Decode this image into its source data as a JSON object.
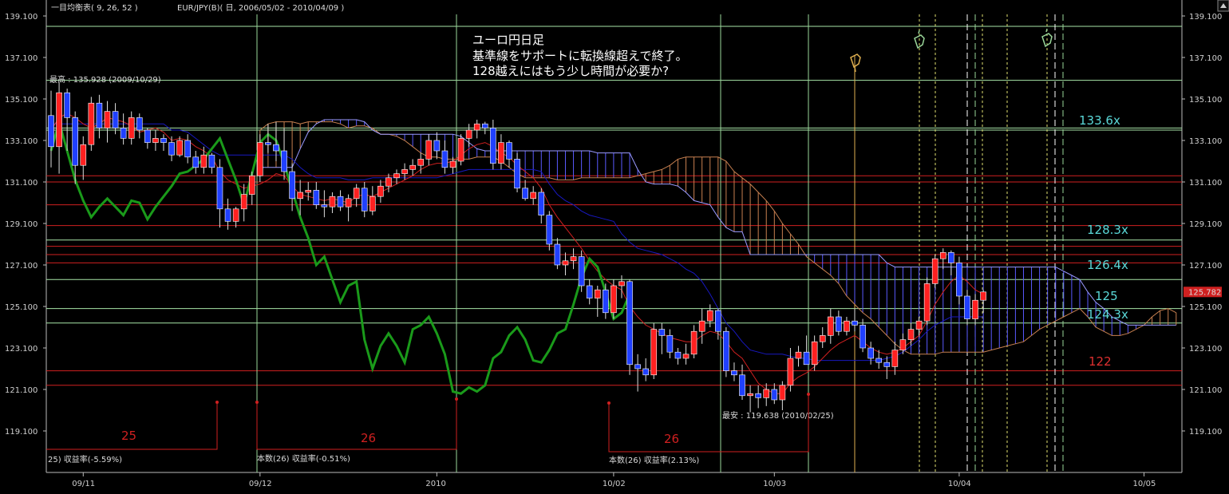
{
  "header": {
    "indicator": "一目均衡表( 9, 26, 52 )",
    "symbol_info": "EUR/JPY(B)( 日, 2006/05/02 - 2010/04/09 )"
  },
  "annotation": [
    "ユーロ円日足",
    "基準線をサポートに転換線超えで終了。",
    "128越えにはもう少し時間が必要か?"
  ],
  "max_label": "最高 : 135.928 (2009/10/29)",
  "min_label": "最安 : 119.638 (2010/02/25)",
  "count_labels": [
    {
      "num": "25",
      "text": "25) 収益率(-5.59%)"
    },
    {
      "num": "26",
      "text": "本数(26) 収益率(-0.51%)"
    },
    {
      "num": "26",
      "text": "本数(26) 収益率(2.13%)"
    }
  ],
  "level_labels": [
    {
      "text": "133.6x",
      "color": "#5ad8d8"
    },
    {
      "text": "128.3x",
      "color": "#5ad8d8"
    },
    {
      "text": "126.4x",
      "color": "#5ad8d8"
    },
    {
      "text": "125",
      "color": "#5ad8d8"
    },
    {
      "text": "124.3x",
      "color": "#5ad8d8"
    },
    {
      "text": "122",
      "color": "#e03030"
    }
  ],
  "current_price": "125.782",
  "colors": {
    "up": "#ff2020",
    "down": "#2040ff",
    "chikou": "#1a9a1a",
    "tenkan": "#d02020",
    "kijun": "#1818c0",
    "cloud_bear": "#5a5aff",
    "cloud_bull": "#c88050",
    "hline_green": "#a8e6a8",
    "hline_red": "#d02020",
    "vline": "#9ad79a",
    "vline_yellow": "#e0e070"
  },
  "chart_data": {
    "type": "candlestick",
    "title": "ユーロ円日足",
    "ylim": [
      117.7,
      139.6
    ],
    "y_ticks": [
      "139.100",
      "137.100",
      "135.100",
      "133.100",
      "131.100",
      "129.100",
      "127.100",
      "125.100",
      "123.100",
      "121.100",
      "119.100"
    ],
    "x_ticks": [
      {
        "label": "09/11",
        "index": 4
      },
      {
        "label": "09/12",
        "index": 26
      },
      {
        "label": "2010",
        "index": 48
      },
      {
        "label": "10/02",
        "index": 70
      },
      {
        "label": "10/03",
        "index": 90
      },
      {
        "label": "10/04",
        "index": 113
      },
      {
        "label": "10/05",
        "index": 136
      }
    ],
    "candles": [
      [
        134.3,
        135.5,
        131.8,
        132.8
      ],
      [
        132.8,
        135.9,
        131.5,
        135.4
      ],
      [
        135.4,
        135.6,
        132.6,
        134.2
      ],
      [
        134.2,
        134.5,
        131.0,
        131.9
      ],
      [
        131.9,
        133.3,
        131.2,
        132.9
      ],
      [
        132.9,
        135.2,
        132.6,
        134.9
      ],
      [
        134.9,
        135.3,
        133.2,
        133.7
      ],
      [
        133.7,
        135.0,
        133.0,
        134.5
      ],
      [
        134.5,
        134.9,
        133.4,
        133.7
      ],
      [
        133.7,
        134.4,
        132.9,
        133.2
      ],
      [
        133.2,
        134.5,
        132.9,
        134.2
      ],
      [
        134.2,
        134.4,
        133.2,
        133.6
      ],
      [
        133.6,
        133.7,
        132.7,
        133.0
      ],
      [
        133.0,
        133.6,
        132.6,
        133.2
      ],
      [
        133.2,
        133.4,
        132.6,
        133.0
      ],
      [
        133.0,
        133.3,
        132.1,
        132.4
      ],
      [
        132.4,
        133.3,
        132.3,
        133.1
      ],
      [
        133.1,
        133.4,
        132.0,
        132.3
      ],
      [
        132.3,
        132.6,
        131.5,
        131.8
      ],
      [
        131.8,
        132.8,
        131.5,
        132.4
      ],
      [
        132.4,
        132.5,
        131.5,
        131.8
      ],
      [
        131.8,
        132.2,
        128.9,
        129.8
      ],
      [
        129.8,
        130.3,
        128.8,
        129.2
      ],
      [
        129.2,
        129.9,
        128.9,
        129.8
      ],
      [
        129.8,
        131.0,
        129.2,
        130.5
      ],
      [
        130.5,
        131.6,
        130.0,
        131.4
      ],
      [
        131.4,
        133.4,
        131.1,
        133.0
      ],
      [
        133.0,
        133.9,
        132.5,
        132.9
      ],
      [
        132.9,
        134.0,
        132.1,
        132.6
      ],
      [
        132.6,
        133.7,
        131.2,
        131.6
      ],
      [
        131.6,
        132.0,
        129.7,
        130.3
      ],
      [
        130.3,
        131.2,
        129.5,
        130.6
      ],
      [
        130.6,
        131.1,
        130.2,
        130.7
      ],
      [
        130.7,
        131.1,
        129.8,
        130.0
      ],
      [
        130.0,
        130.7,
        129.4,
        129.9
      ],
      [
        129.9,
        130.6,
        129.6,
        130.4
      ],
      [
        130.4,
        130.7,
        129.7,
        129.9
      ],
      [
        129.9,
        130.5,
        129.2,
        130.3
      ],
      [
        130.3,
        131.0,
        129.9,
        130.8
      ],
      [
        130.8,
        131.1,
        129.4,
        129.7
      ],
      [
        129.7,
        130.9,
        129.5,
        130.4
      ],
      [
        130.4,
        131.2,
        130.1,
        130.9
      ],
      [
        130.9,
        131.5,
        130.6,
        131.3
      ],
      [
        131.3,
        131.7,
        131.0,
        131.5
      ],
      [
        131.5,
        132.0,
        131.2,
        131.7
      ],
      [
        131.7,
        132.2,
        131.4,
        131.9
      ],
      [
        131.9,
        132.5,
        131.5,
        132.2
      ],
      [
        132.2,
        133.4,
        131.9,
        133.1
      ],
      [
        133.1,
        133.5,
        132.2,
        132.6
      ],
      [
        132.6,
        133.1,
        131.5,
        131.8
      ],
      [
        131.8,
        132.3,
        131.5,
        132.1
      ],
      [
        132.1,
        133.4,
        131.9,
        133.2
      ],
      [
        133.2,
        133.9,
        132.8,
        133.6
      ],
      [
        133.6,
        134.1,
        133.2,
        133.9
      ],
      [
        133.9,
        134.0,
        133.4,
        133.7
      ],
      [
        133.7,
        134.1,
        131.7,
        132.0
      ],
      [
        132.0,
        133.4,
        131.7,
        133.0
      ],
      [
        133.0,
        133.1,
        131.8,
        132.2
      ],
      [
        132.2,
        132.5,
        130.6,
        130.8
      ],
      [
        130.8,
        131.2,
        130.2,
        130.3
      ],
      [
        130.3,
        130.9,
        130.0,
        130.6
      ],
      [
        130.6,
        130.8,
        129.1,
        129.5
      ],
      [
        129.5,
        129.7,
        127.8,
        128.1
      ],
      [
        128.1,
        128.4,
        126.9,
        127.1
      ],
      [
        127.1,
        127.7,
        126.6,
        127.3
      ],
      [
        127.3,
        127.9,
        126.9,
        127.5
      ],
      [
        127.5,
        127.8,
        125.8,
        126.1
      ],
      [
        126.1,
        126.4,
        125.2,
        125.5
      ],
      [
        125.5,
        126.1,
        124.6,
        125.9
      ],
      [
        125.9,
        126.2,
        124.5,
        124.8
      ],
      [
        124.8,
        126.4,
        124.5,
        126.1
      ],
      [
        126.1,
        126.6,
        125.5,
        126.3
      ],
      [
        126.3,
        126.4,
        121.8,
        122.3
      ],
      [
        122.3,
        122.8,
        121.0,
        122.1
      ],
      [
        122.1,
        122.6,
        121.5,
        121.8
      ],
      [
        121.8,
        124.3,
        121.6,
        124.0
      ],
      [
        124.0,
        124.3,
        122.8,
        123.7
      ],
      [
        123.7,
        124.0,
        122.6,
        122.9
      ],
      [
        122.9,
        123.1,
        122.3,
        122.6
      ],
      [
        122.6,
        123.3,
        122.3,
        122.8
      ],
      [
        122.8,
        124.2,
        122.6,
        123.9
      ],
      [
        123.9,
        125.0,
        123.3,
        124.4
      ],
      [
        124.4,
        125.2,
        124.1,
        124.9
      ],
      [
        124.9,
        125.0,
        123.5,
        123.9
      ],
      [
        123.9,
        124.1,
        121.7,
        122.0
      ],
      [
        122.0,
        122.4,
        121.5,
        121.8
      ],
      [
        121.8,
        122.3,
        120.6,
        120.8
      ],
      [
        120.8,
        121.3,
        120.0,
        120.9
      ],
      [
        120.9,
        121.3,
        120.2,
        120.7
      ],
      [
        120.7,
        121.4,
        120.3,
        121.1
      ],
      [
        121.1,
        121.4,
        120.4,
        120.6
      ],
      [
        120.6,
        121.5,
        120.1,
        121.3
      ],
      [
        121.3,
        123.1,
        121.0,
        122.6
      ],
      [
        122.6,
        123.2,
        122.2,
        122.9
      ],
      [
        122.9,
        123.7,
        122.5,
        122.3
      ],
      [
        122.3,
        123.7,
        122.0,
        123.4
      ],
      [
        123.4,
        124.1,
        123.1,
        123.7
      ],
      [
        123.7,
        125.0,
        123.3,
        124.6
      ],
      [
        124.6,
        124.9,
        123.7,
        123.9
      ],
      [
        123.9,
        124.6,
        123.7,
        124.4
      ],
      [
        124.4,
        125.0,
        123.9,
        124.2
      ],
      [
        124.2,
        124.5,
        122.9,
        123.1
      ],
      [
        123.1,
        123.4,
        122.3,
        122.6
      ],
      [
        122.6,
        123.0,
        122.1,
        122.4
      ],
      [
        122.4,
        122.7,
        121.6,
        122.2
      ],
      [
        122.2,
        123.4,
        121.8,
        123.0
      ],
      [
        123.0,
        123.8,
        122.8,
        123.5
      ],
      [
        123.5,
        124.3,
        123.2,
        124.0
      ],
      [
        124.0,
        124.6,
        123.7,
        124.4
      ],
      [
        124.4,
        126.5,
        124.2,
        126.2
      ],
      [
        126.2,
        127.6,
        126.0,
        127.4
      ],
      [
        127.4,
        127.9,
        126.9,
        127.7
      ],
      [
        127.7,
        127.8,
        126.6,
        127.2
      ],
      [
        127.2,
        127.5,
        125.2,
        125.6
      ],
      [
        125.6,
        125.9,
        124.2,
        124.5
      ],
      [
        124.5,
        125.7,
        124.2,
        125.4
      ],
      [
        125.4,
        125.9,
        124.8,
        125.8
      ]
    ],
    "tenkan": [
      133.6,
      134.2,
      134.4,
      134.2,
      133.9,
      133.7,
      133.9,
      134.2,
      134.1,
      134.0,
      133.8,
      133.5,
      133.6,
      133.7,
      133.5,
      133.1,
      133.2,
      133.1,
      132.8,
      132.6,
      132.3,
      131.6,
      131.2,
      131.0,
      130.8,
      130.9,
      131.0,
      131.2,
      131.5,
      131.4,
      130.9,
      130.5,
      130.4,
      130.3,
      130.2,
      130.3,
      130.2,
      130.1,
      130.4,
      130.5,
      130.4,
      130.6,
      130.8,
      131.0,
      131.2,
      131.4,
      131.7,
      131.9,
      132.0,
      132.0,
      132.1,
      132.4,
      132.7,
      132.9,
      133.0,
      132.8,
      132.5,
      132.3,
      131.9,
      131.6,
      131.3,
      130.8,
      130.0,
      129.4,
      128.9,
      128.4,
      127.9,
      127.3,
      126.8,
      126.4,
      126.1,
      125.9,
      125.1,
      124.6,
      124.2,
      124.0,
      123.8,
      123.6,
      123.5,
      123.4,
      123.4,
      123.7,
      123.9,
      123.8,
      123.4,
      122.9,
      122.6,
      122.0,
      121.4,
      121.1,
      120.9,
      120.9,
      121.4,
      121.7,
      121.9,
      122.2,
      122.6,
      123.0,
      123.3,
      123.5,
      123.7,
      123.4,
      123.1,
      122.9,
      122.8,
      122.9,
      123.1,
      123.4,
      123.7,
      124.4,
      125.2,
      125.8,
      126.3,
      126.6,
      126.3,
      125.9,
      125.7
    ],
    "kijun": [
      133.9,
      133.9,
      133.9,
      133.9,
      133.9,
      133.9,
      133.9,
      133.9,
      133.9,
      133.9,
      133.9,
      133.9,
      133.9,
      133.9,
      133.9,
      133.6,
      133.6,
      133.5,
      133.2,
      132.9,
      132.6,
      132.4,
      132.4,
      132.4,
      132.4,
      132.4,
      132.4,
      132.4,
      132.4,
      132.4,
      132.2,
      131.8,
      131.5,
      131.3,
      131.3,
      131.3,
      131.3,
      131.2,
      131.2,
      131.2,
      131.3,
      131.3,
      131.3,
      131.3,
      131.3,
      131.3,
      131.3,
      131.3,
      131.3,
      131.4,
      131.5,
      131.6,
      131.7,
      131.7,
      131.7,
      131.7,
      131.7,
      131.7,
      131.7,
      131.7,
      131.7,
      131.6,
      131.0,
      130.5,
      130.2,
      130.0,
      129.7,
      129.5,
      129.4,
      129.3,
      129.2,
      128.6,
      128.2,
      127.9,
      127.8,
      127.7,
      127.6,
      127.4,
      127.2,
      126.9,
      126.7,
      126.3,
      125.7,
      125.0,
      124.3,
      123.9,
      123.4,
      123.0,
      122.9,
      122.8,
      122.8,
      122.8,
      122.7,
      122.6,
      122.6,
      122.5,
      122.5,
      122.5,
      122.5,
      122.5,
      122.5,
      122.5,
      122.5,
      122.5,
      122.6,
      122.7,
      122.9,
      123.2,
      123.5,
      123.9,
      124.2,
      124.4,
      124.6,
      124.6,
      124.6,
      124.6,
      124.6
    ],
    "chikou": [
      132.6,
      134.0,
      132.6,
      131.2,
      130.2,
      129.4,
      129.9,
      130.3,
      129.9,
      129.5,
      130.2,
      130.1,
      129.3,
      129.9,
      130.4,
      130.9,
      131.5,
      131.6,
      131.9,
      132.2,
      132.7,
      133.2,
      132.2,
      131.2,
      130.0,
      131.5,
      133.0,
      133.4,
      133.1,
      132.0,
      130.7,
      129.4,
      128.4,
      127.1,
      127.5,
      126.4,
      125.3,
      126.1,
      126.3,
      123.5,
      122.1,
      123.2,
      123.8,
      123.2,
      122.4,
      124.0,
      124.2,
      124.6,
      123.8,
      122.8,
      121.0,
      120.9,
      121.2,
      121.0,
      121.3,
      122.6,
      122.9,
      123.7,
      124.1,
      123.5,
      122.5,
      122.4,
      123.0,
      123.8,
      124.0,
      125.2,
      126.5,
      127.4,
      127.0,
      125.8,
      124.5,
      124.8,
      125.7
    ],
    "senkou_a": [
      133.6,
      133.9,
      134.0,
      134.0,
      134.0,
      133.9,
      134.0,
      134.0,
      134.0,
      134.0,
      133.9,
      133.7,
      133.8,
      133.8,
      133.7,
      133.4,
      133.4,
      133.3,
      133.1,
      132.8,
      132.5,
      132.3,
      132.3,
      132.2,
      132.2,
      132.2,
      132.2,
      132.3,
      132.3,
      132.3,
      132.1,
      131.8,
      131.5,
      131.3,
      131.3,
      131.3,
      131.3,
      131.2,
      131.2,
      131.2,
      131.3,
      131.3,
      131.3,
      131.3,
      131.3,
      131.3,
      131.3,
      131.4,
      131.5,
      131.6,
      131.7,
      131.9,
      132.2,
      132.3,
      132.3,
      132.3,
      132.3,
      132.3,
      132.1,
      131.6,
      131.3,
      131.0,
      130.6,
      130.2,
      129.7,
      129.1,
      128.6,
      128.1,
      127.5,
      127.2,
      126.9,
      126.6,
      126.2,
      125.6,
      125.2,
      124.8,
      124.5,
      124.1,
      123.7,
      123.3,
      123.0,
      122.8,
      122.8,
      122.8,
      122.8,
      122.9,
      122.9,
      122.9,
      122.9,
      122.9,
      122.9,
      123.0,
      123.1,
      123.2,
      123.3,
      123.4,
      123.7,
      124.0,
      124.2,
      124.4,
      124.6,
      124.8,
      125.0,
      124.6,
      124.1,
      123.9,
      123.7,
      123.7,
      123.8,
      124.0,
      124.2,
      124.6,
      124.9,
      125.0,
      124.8,
      124.6,
      124.8,
      125.0
    ],
    "senkou_b": [
      131.8,
      131.8,
      131.8,
      131.8,
      131.8,
      132.7,
      133.5,
      133.9,
      134.1,
      134.1,
      134.1,
      134.1,
      134.1,
      134.0,
      133.6,
      133.4,
      133.4,
      133.4,
      133.4,
      133.4,
      133.4,
      133.4,
      133.4,
      133.4,
      133.4,
      133.3,
      133.0,
      132.7,
      132.6,
      132.6,
      132.6,
      132.6,
      132.6,
      132.6,
      132.6,
      132.6,
      132.6,
      132.6,
      132.6,
      132.6,
      132.6,
      132.6,
      132.5,
      132.5,
      132.5,
      132.5,
      132.5,
      131.7,
      131.1,
      131.0,
      131.0,
      131.0,
      130.9,
      130.6,
      130.2,
      130.1,
      130.0,
      129.4,
      128.9,
      128.7,
      128.7,
      127.6,
      127.6,
      127.6,
      127.6,
      127.6,
      127.6,
      127.6,
      127.6,
      127.6,
      127.6,
      127.6,
      127.6,
      127.6,
      127.6,
      127.6,
      127.6,
      127.6,
      127.2,
      127.0,
      127.0,
      127.0,
      127.0,
      127.0,
      127.0,
      127.0,
      127.0,
      127.0,
      127.0,
      127.0,
      127.0,
      127.0,
      127.0,
      127.0,
      127.0,
      127.0,
      127.0,
      127.0,
      127.0,
      127.0,
      126.8,
      126.6,
      126.4,
      125.8,
      125.3,
      125.0,
      124.6,
      124.4,
      124.2,
      124.2,
      124.2,
      124.2,
      124.2,
      124.2,
      124.2,
      124.2,
      124.2,
      124.2
    ],
    "cloud_offset": 26,
    "hlines_green": [
      138.6,
      136.0,
      133.7,
      133.6,
      128.3,
      126.4,
      125.0,
      124.3
    ],
    "hlines_red": [
      131.4,
      131.1,
      130.0,
      129.0,
      128.0,
      127.6,
      127.2,
      122.0,
      121.3
    ]
  }
}
